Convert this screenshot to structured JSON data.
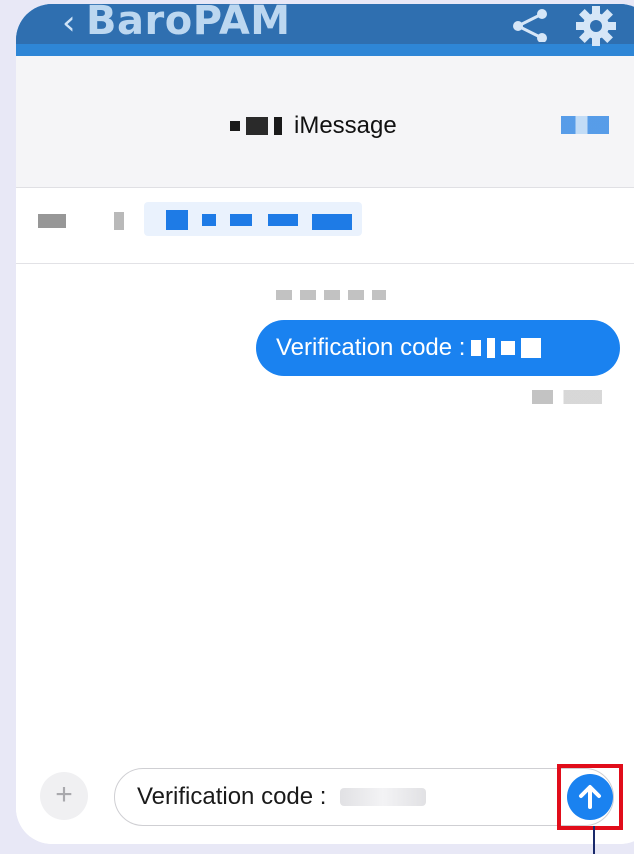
{
  "app_bar": {
    "back_icon": "chevron-left-icon",
    "title": "BaroPAM",
    "share_icon": "share-icon",
    "settings_icon": "gear-icon",
    "color": "#2e86d6"
  },
  "message_header": {
    "contact_service": "iMessage"
  },
  "thread": {
    "message_text": "Verification code :",
    "bubble_color": "#1a82f0"
  },
  "composer": {
    "attach_label": "+",
    "field_value": "Verification code :",
    "send_icon": "arrow-up-icon",
    "highlight_color": "#e10d1a"
  }
}
